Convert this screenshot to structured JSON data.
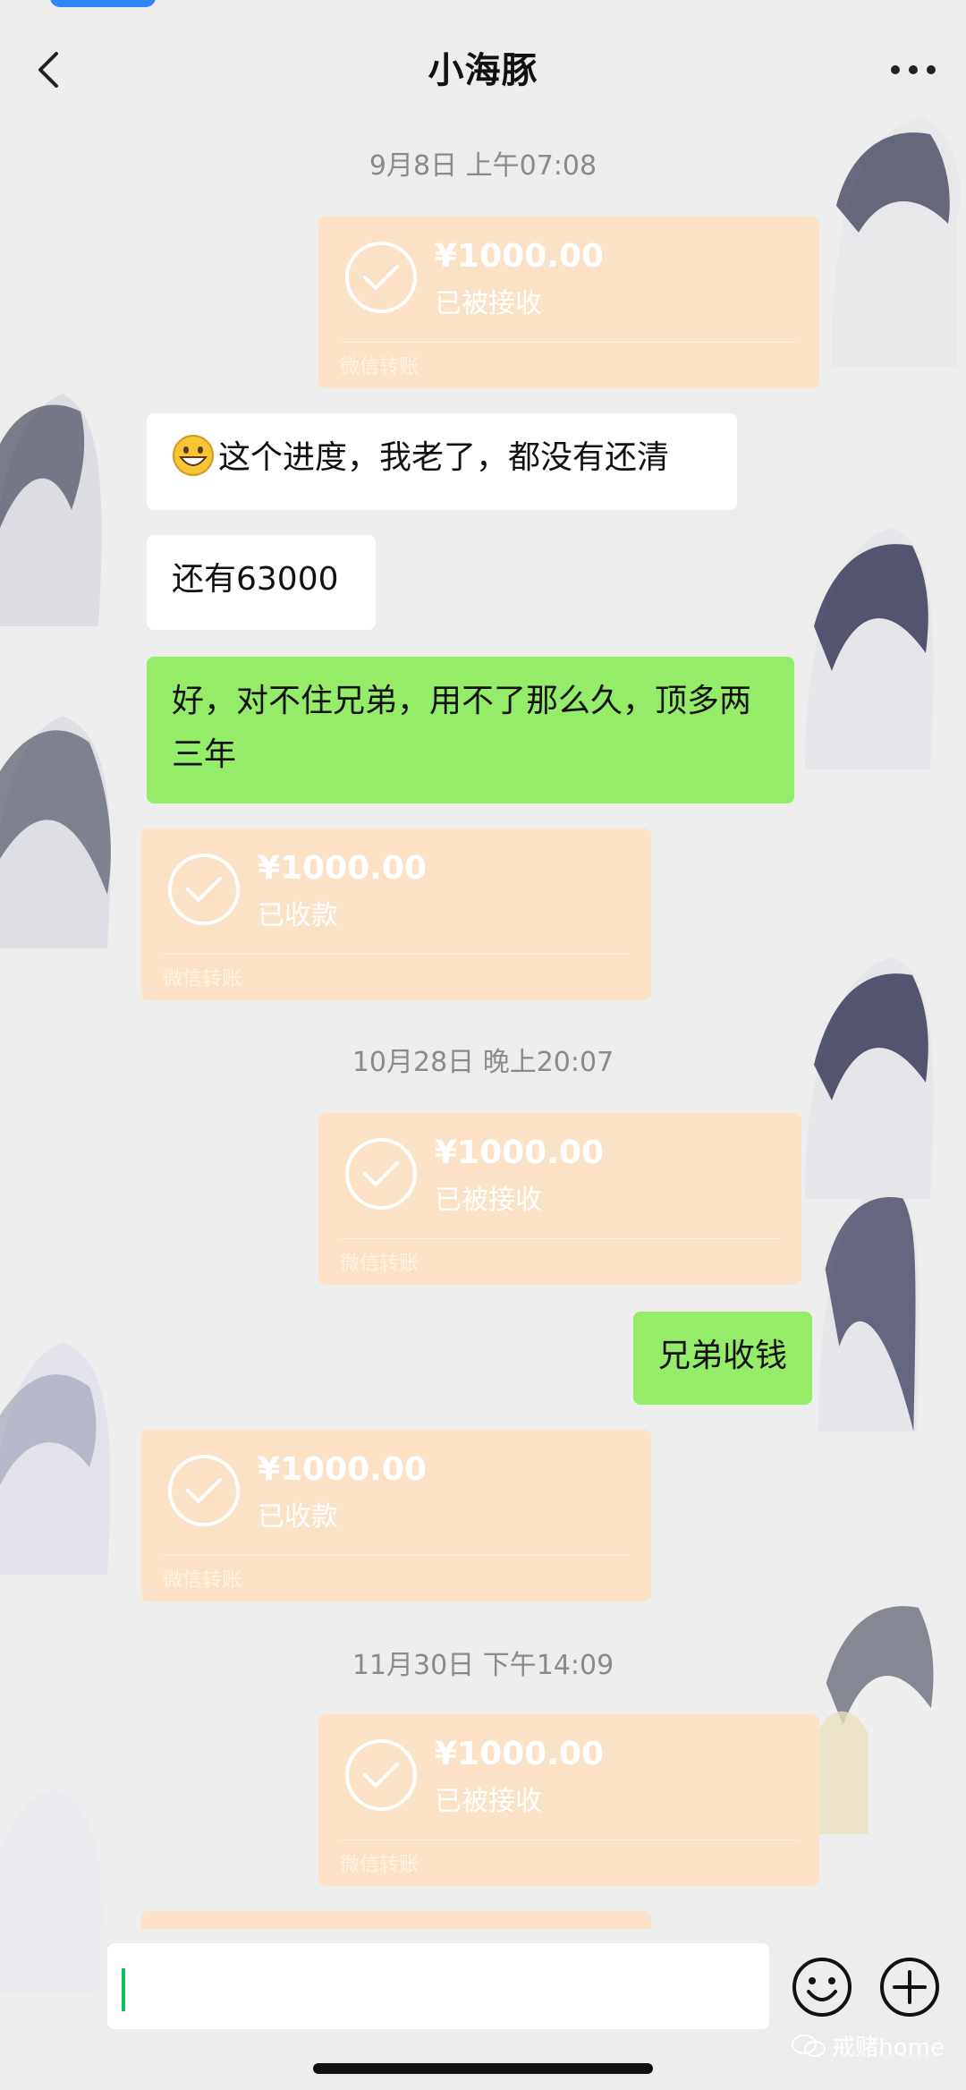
{
  "header": {
    "title": "小海豚"
  },
  "messages": [
    {
      "type": "time",
      "text": "9月8日 上午07:08"
    },
    {
      "type": "transfer",
      "amount": "¥1000.00",
      "status": "已被接收",
      "label": "微信转账"
    },
    {
      "type": "text",
      "text": "这个进度，我老了，都没有还清"
    },
    {
      "type": "text",
      "text": "还有63000"
    },
    {
      "type": "text",
      "text": "好，对不住兄弟，用不了那么久，顶多两三年"
    },
    {
      "type": "transfer",
      "amount": "¥1000.00",
      "status": "已收款",
      "label": "微信转账"
    },
    {
      "type": "time",
      "text": "10月28日 晚上20:07"
    },
    {
      "type": "transfer",
      "amount": "¥1000.00",
      "status": "已被接收",
      "label": "微信转账"
    },
    {
      "type": "text",
      "text": "兄弟收钱"
    },
    {
      "type": "transfer",
      "amount": "¥1000.00",
      "status": "已收款",
      "label": "微信转账"
    },
    {
      "type": "time",
      "text": "11月30日 下午14:09"
    },
    {
      "type": "transfer",
      "amount": "¥1000.00",
      "status": "已被接收",
      "label": "微信转账"
    }
  ],
  "watermark": "戒赌home",
  "colors": {
    "transfer": "#fbe1c6",
    "sent_bubble": "#95ec69",
    "received_bubble": "#ffffff",
    "caret": "#07c160"
  }
}
